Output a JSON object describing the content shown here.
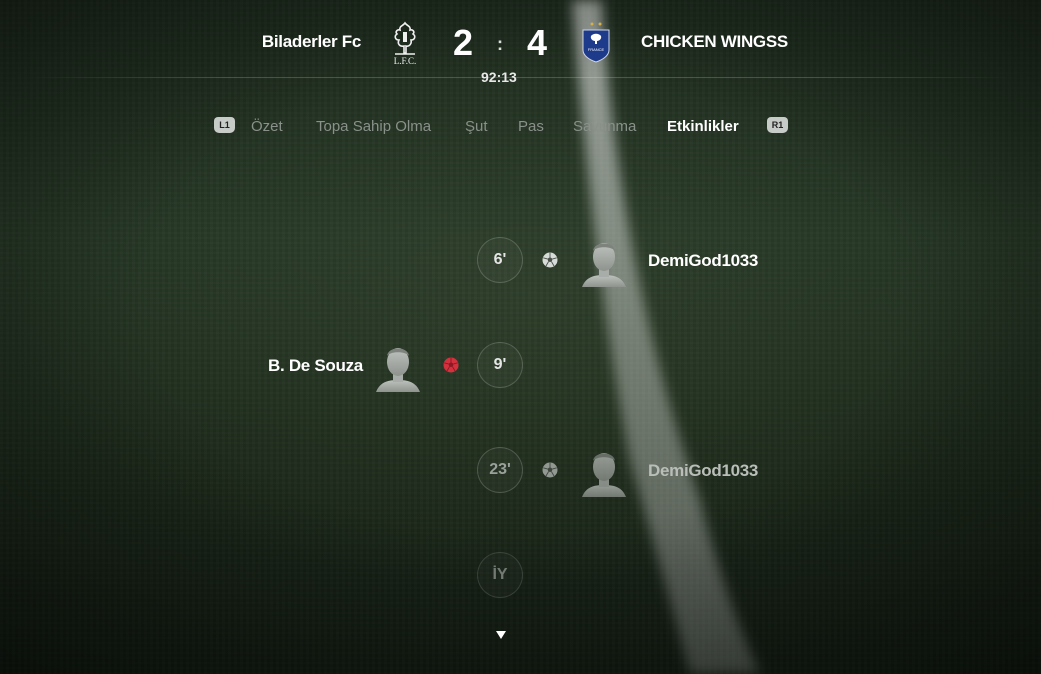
{
  "header": {
    "home_team": "Biladerler Fc",
    "away_team": "CHICKEN WINGSS",
    "home_score": "2",
    "away_score": "4",
    "score_separator": ":",
    "clock": "92:13",
    "home_crest_icon": "liverpool-crest-icon",
    "away_crest_icon": "france-crest-icon"
  },
  "tabs": {
    "left_bumper": "L1",
    "right_bumper": "R1",
    "items": [
      {
        "label": "Özet"
      },
      {
        "label": "Topa Sahip Olma"
      },
      {
        "label": "Şut"
      },
      {
        "label": "Pas"
      },
      {
        "label": "Savunma"
      },
      {
        "label": "Etkinlikler"
      }
    ],
    "active": "Etkinlikler"
  },
  "events": [
    {
      "minute": "6'",
      "side": "away",
      "type": "goal",
      "player": "DemiGod1033"
    },
    {
      "minute": "9'",
      "side": "home",
      "type": "red-card",
      "player": "B. De Souza"
    },
    {
      "minute": "23'",
      "side": "away",
      "type": "goal",
      "player": "DemiGod1033"
    },
    {
      "minute": "İY",
      "side": "none",
      "type": "half-time",
      "player": ""
    }
  ],
  "colors": {
    "active_tab": "#ffffff",
    "inactive_tab": "#8a908a",
    "red_card": "#d4313f",
    "france_blue": "#1e3a8a"
  }
}
